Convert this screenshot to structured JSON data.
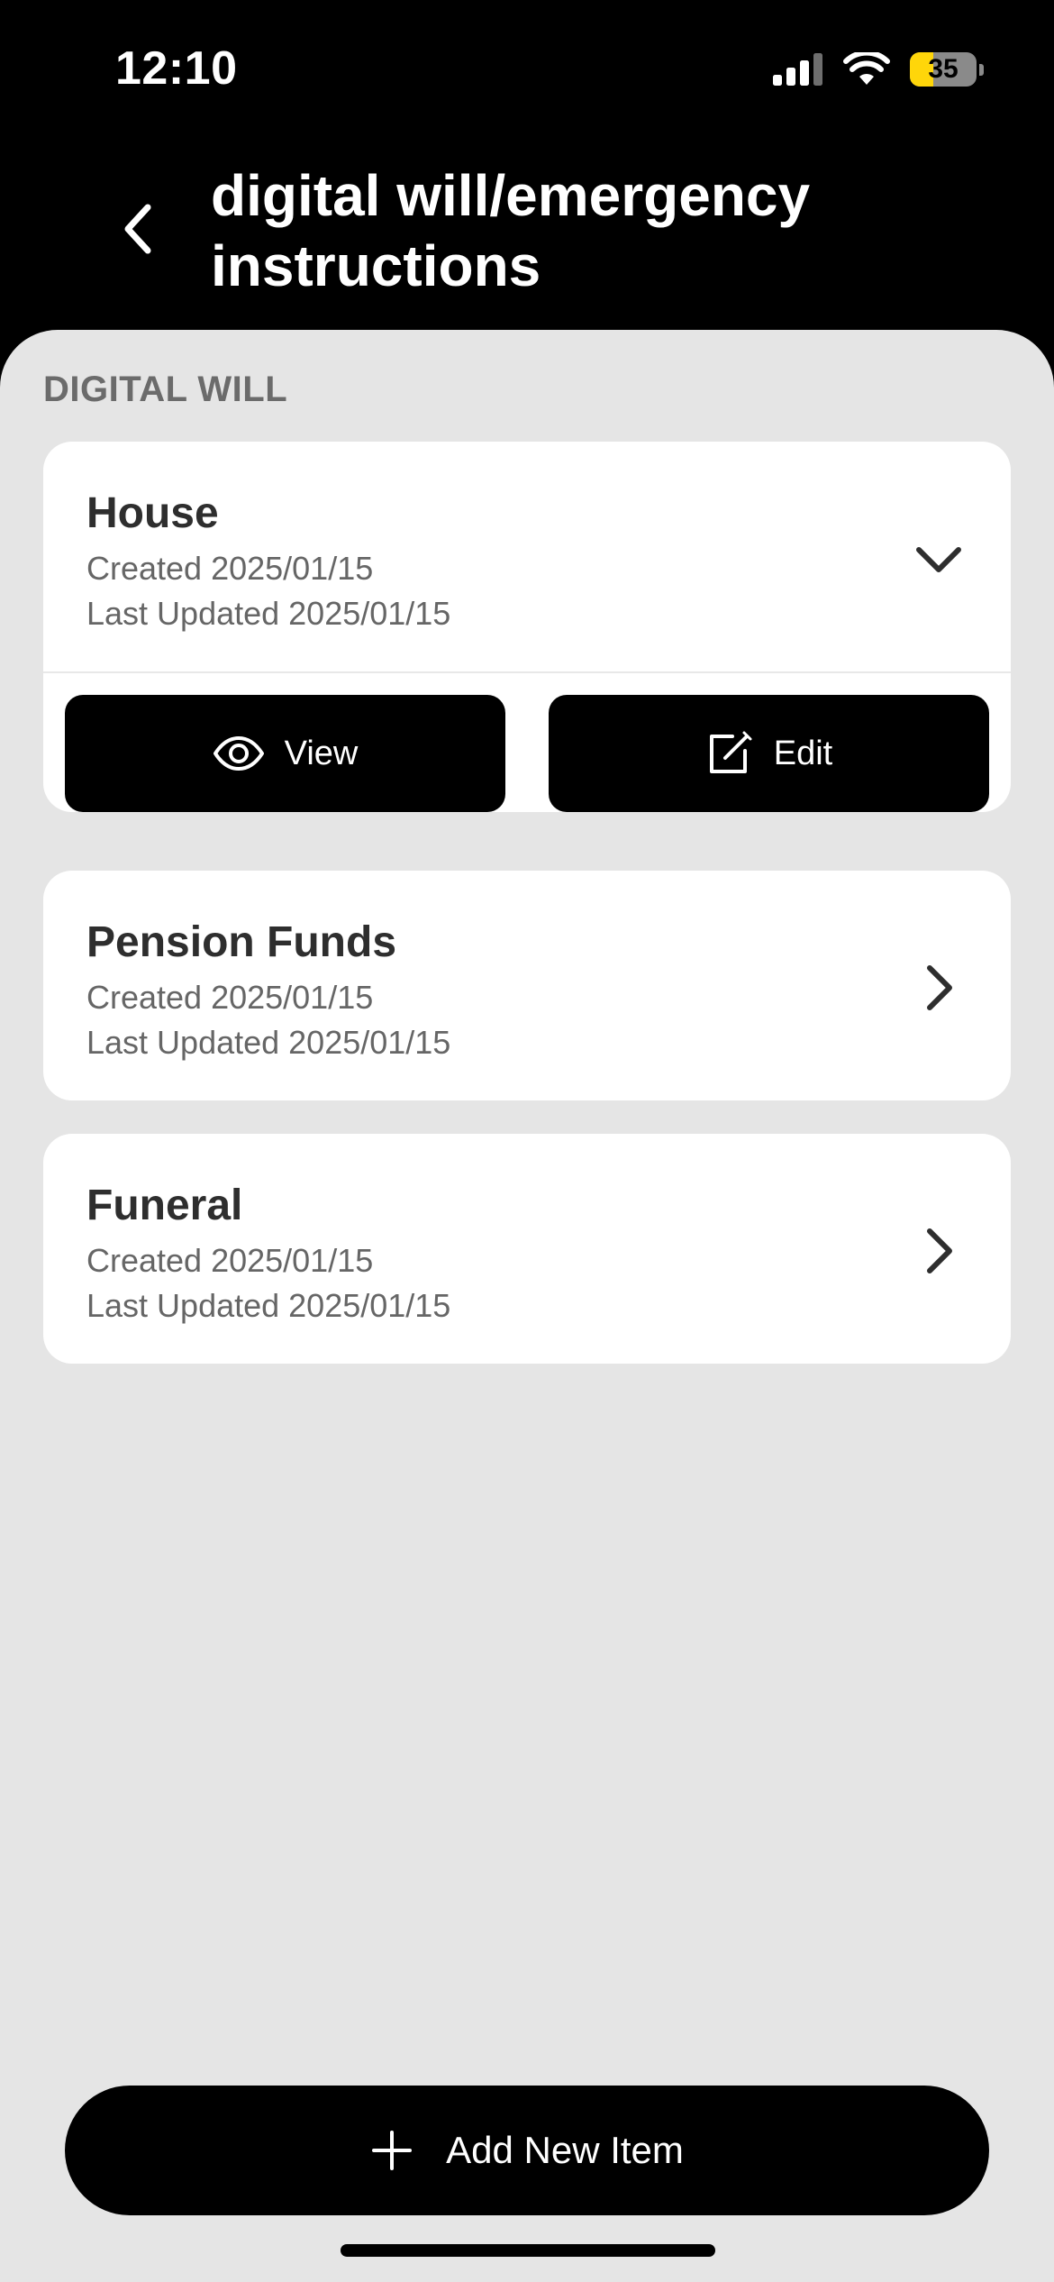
{
  "status_bar": {
    "time": "12:10",
    "battery_level": "35",
    "battery_fill_fraction": 0.35,
    "icons": [
      "cellular-signal-icon",
      "wifi-icon",
      "battery-icon"
    ]
  },
  "header": {
    "title": "digital will/emergency instructions",
    "back_icon": "chevron-left-icon"
  },
  "section": {
    "label": "DIGITAL WILL"
  },
  "items": [
    {
      "title": "House",
      "created": "Created 2025/01/15",
      "updated": "Last Updated 2025/01/15",
      "expanded": true,
      "chevron": "chevron-down-icon",
      "actions": [
        {
          "label": "View",
          "icon": "eye-icon"
        },
        {
          "label": "Edit",
          "icon": "edit-icon"
        }
      ]
    },
    {
      "title": "Pension Funds",
      "created": "Created 2025/01/15",
      "updated": "Last Updated 2025/01/15",
      "expanded": false,
      "chevron": "chevron-right-icon"
    },
    {
      "title": "Funeral",
      "created": "Created 2025/01/15",
      "updated": "Last Updated 2025/01/15",
      "expanded": false,
      "chevron": "chevron-right-icon"
    }
  ],
  "footer": {
    "add_label": "Add New Item",
    "add_icon": "plus-icon"
  },
  "colors": {
    "background_dark": "#000000",
    "sheet_background": "#e5e5e5",
    "card_background": "#ffffff",
    "battery_accent": "#ffd60a",
    "section_label": "#6b6b6b"
  }
}
